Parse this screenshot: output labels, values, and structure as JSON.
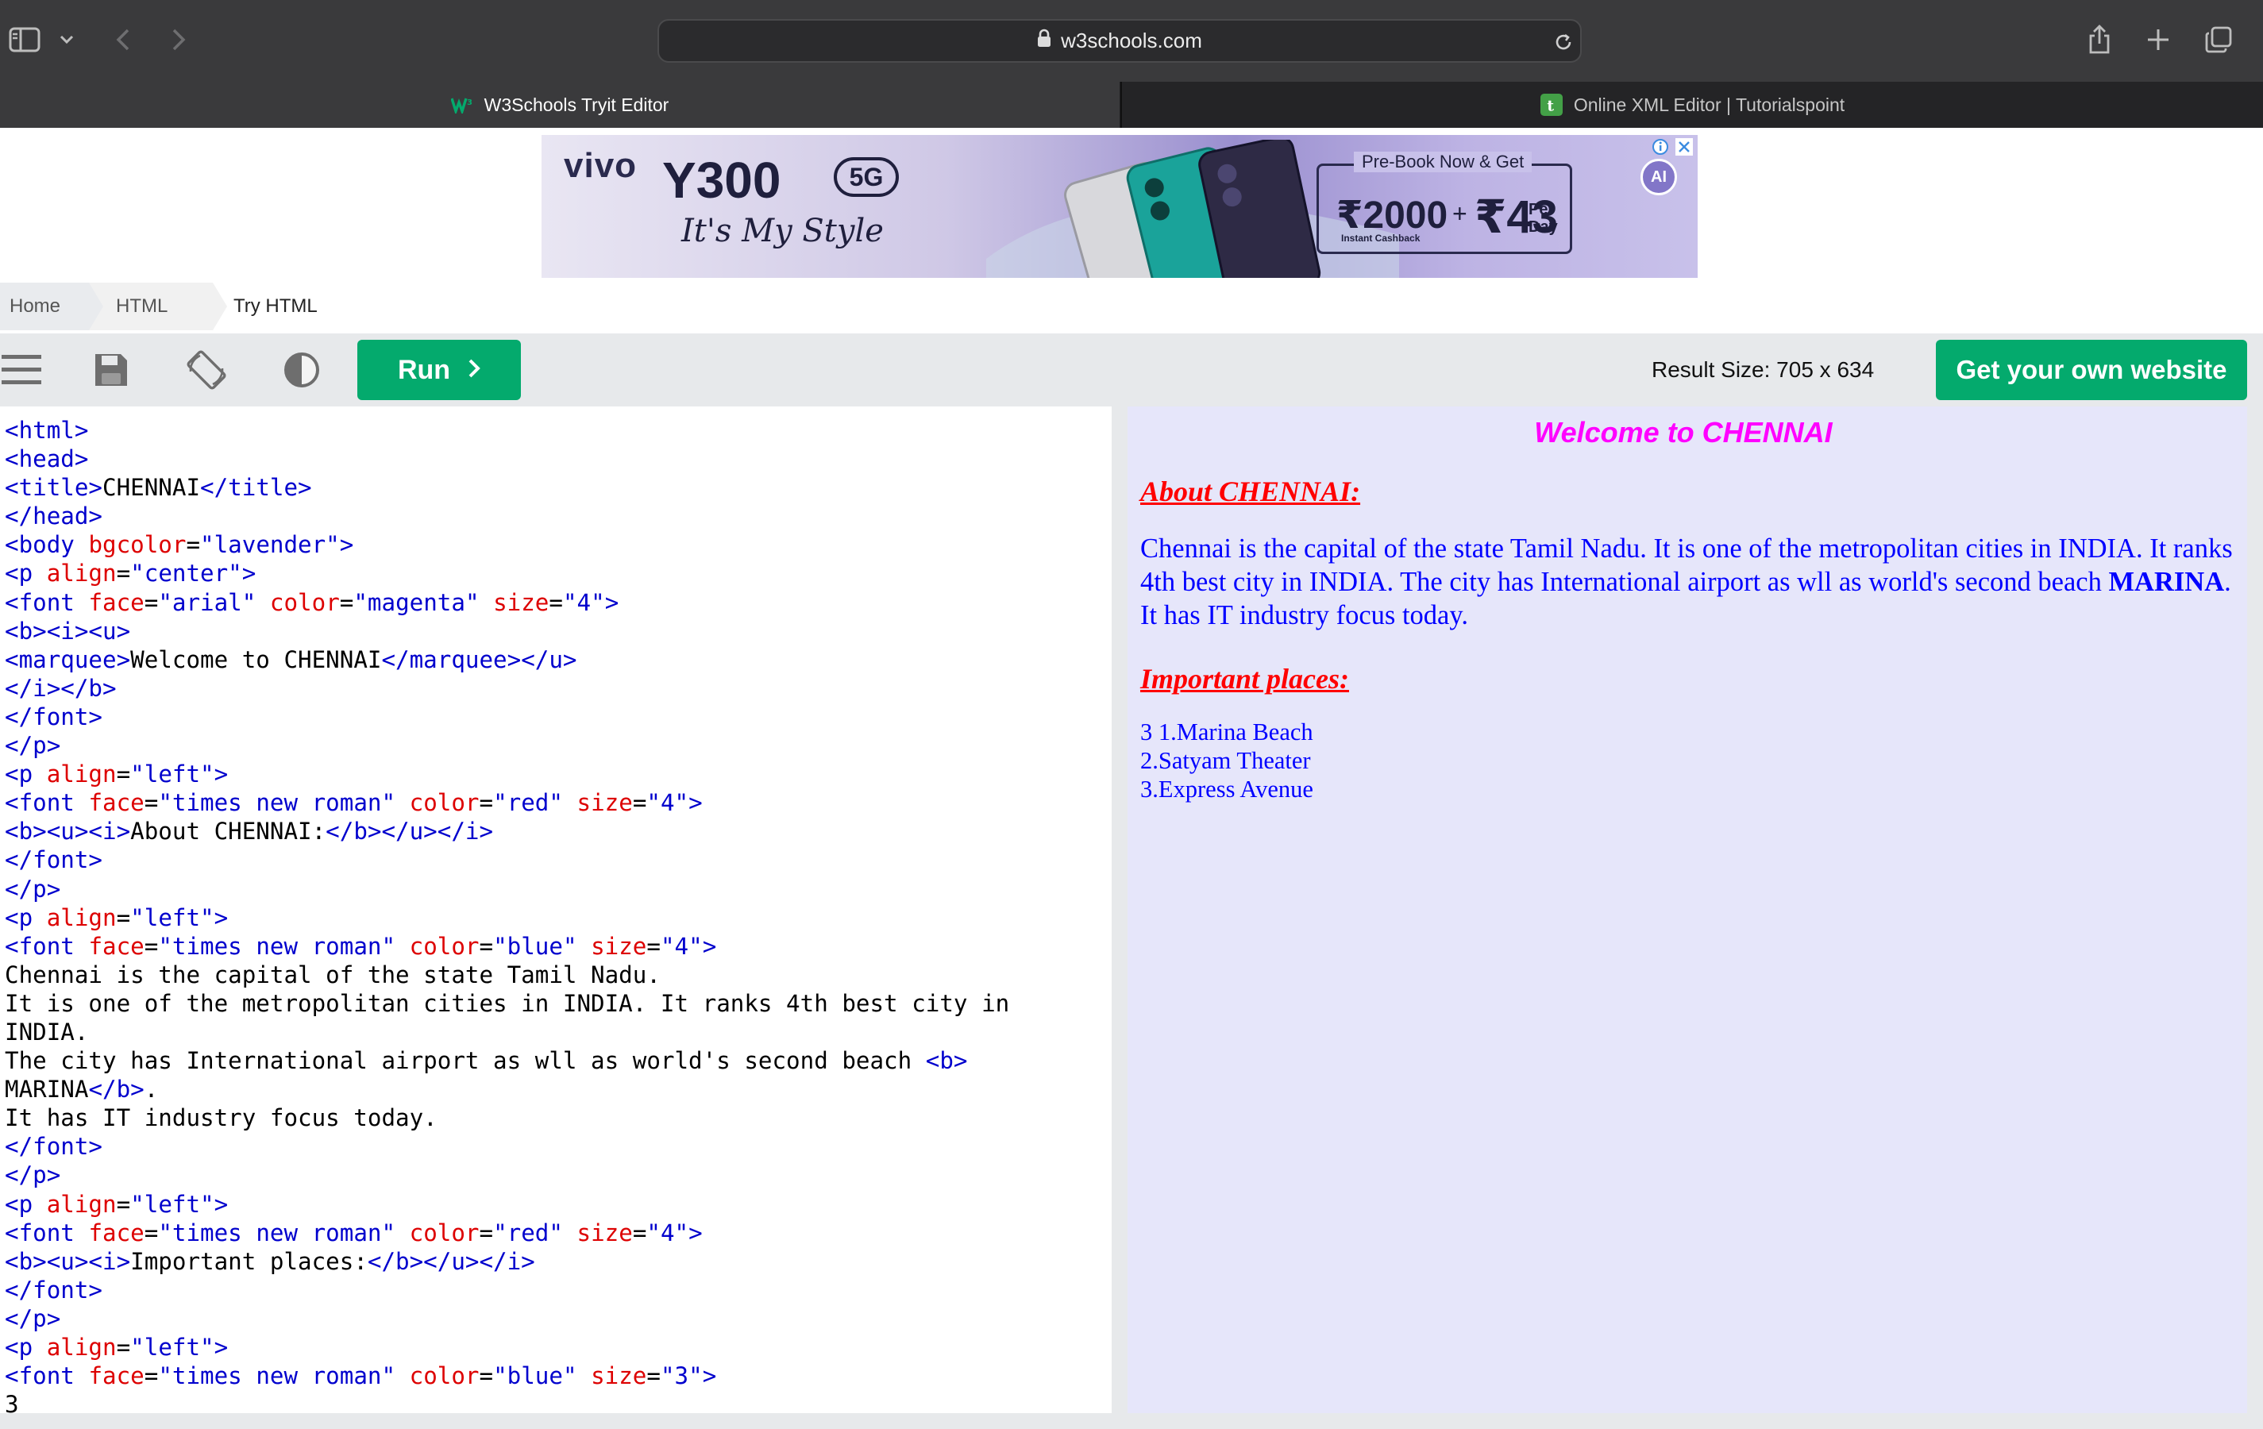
{
  "browser": {
    "url": "w3schools.com",
    "tabs": [
      {
        "label": "W3Schools Tryit Editor",
        "active": true,
        "icon": "w3schools-favicon"
      },
      {
        "label": "Online XML Editor | Tutorialspoint",
        "active": false,
        "icon": "tutorialspoint-favicon"
      }
    ]
  },
  "ad": {
    "brand": "vivo",
    "model": "Y300",
    "badge": "5G",
    "tagline": "It's My Style",
    "offer_title": "Pre-Book Now & Get",
    "amount1": "₹2000",
    "amount_sep": "+",
    "amount2": "₹43",
    "per": "Per",
    "day": "Day",
    "cashback": "Instant Cashback",
    "ai_label": "AI"
  },
  "breadcrumb": [
    "Home",
    "HTML",
    "Try HTML"
  ],
  "toolbar": {
    "run_label": "Run",
    "result_size": "Result Size: 705 x 634",
    "own_website": "Get your own website"
  },
  "editor": {
    "lines": [
      [
        [
          "tg",
          "<html>"
        ]
      ],
      [
        [
          "tg",
          "<head>"
        ]
      ],
      [
        [
          "tg",
          "<title>"
        ],
        [
          "tx",
          "CHENNAI"
        ],
        [
          "tg",
          "</title>"
        ]
      ],
      [
        [
          "tg",
          "</head>"
        ]
      ],
      [
        [
          "tg",
          "<body "
        ],
        [
          "at",
          "bgcolor"
        ],
        [
          "tx",
          "="
        ],
        [
          "vl",
          "\"lavender\""
        ],
        [
          "tg",
          ">"
        ]
      ],
      [
        [
          "tg",
          "<p "
        ],
        [
          "at",
          "align"
        ],
        [
          "tx",
          "="
        ],
        [
          "vl",
          "\"center\""
        ],
        [
          "tg",
          ">"
        ]
      ],
      [
        [
          "tg",
          "<font "
        ],
        [
          "at",
          "face"
        ],
        [
          "tx",
          "="
        ],
        [
          "vl",
          "\"arial\""
        ],
        [
          "tx",
          " "
        ],
        [
          "at",
          "color"
        ],
        [
          "tx",
          "="
        ],
        [
          "vl",
          "\"magenta\""
        ],
        [
          "tx",
          " "
        ],
        [
          "at",
          "size"
        ],
        [
          "tx",
          "="
        ],
        [
          "vl",
          "\"4\""
        ],
        [
          "tg",
          ">"
        ]
      ],
      [
        [
          "tg",
          "<b><i><u>"
        ]
      ],
      [
        [
          "tg",
          "<marquee>"
        ],
        [
          "tx",
          "Welcome to CHENNAI"
        ],
        [
          "tg",
          "</marquee></u>"
        ]
      ],
      [
        [
          "tg",
          "</i></b>"
        ]
      ],
      [
        [
          "tg",
          "</font>"
        ]
      ],
      [
        [
          "tg",
          "</p>"
        ]
      ],
      [
        [
          "tg",
          "<p "
        ],
        [
          "at",
          "align"
        ],
        [
          "tx",
          "="
        ],
        [
          "vl",
          "\"left\""
        ],
        [
          "tg",
          ">"
        ]
      ],
      [
        [
          "tg",
          "<font "
        ],
        [
          "at",
          "face"
        ],
        [
          "tx",
          "="
        ],
        [
          "vl",
          "\"times new roman\""
        ],
        [
          "tx",
          " "
        ],
        [
          "at",
          "color"
        ],
        [
          "tx",
          "="
        ],
        [
          "vl",
          "\"red\""
        ],
        [
          "tx",
          " "
        ],
        [
          "at",
          "size"
        ],
        [
          "tx",
          "="
        ],
        [
          "vl",
          "\"4\""
        ],
        [
          "tg",
          ">"
        ]
      ],
      [
        [
          "tg",
          "<b><u><i>"
        ],
        [
          "tx",
          "About CHENNAI:"
        ],
        [
          "tg",
          "</b></u></i>"
        ]
      ],
      [
        [
          "tg",
          "</font>"
        ]
      ],
      [
        [
          "tg",
          "</p>"
        ]
      ],
      [
        [
          "tg",
          "<p "
        ],
        [
          "at",
          "align"
        ],
        [
          "tx",
          "="
        ],
        [
          "vl",
          "\"left\""
        ],
        [
          "tg",
          ">"
        ]
      ],
      [
        [
          "tg",
          "<font "
        ],
        [
          "at",
          "face"
        ],
        [
          "tx",
          "="
        ],
        [
          "vl",
          "\"times new roman\""
        ],
        [
          "tx",
          " "
        ],
        [
          "at",
          "color"
        ],
        [
          "tx",
          "="
        ],
        [
          "vl",
          "\"blue\""
        ],
        [
          "tx",
          " "
        ],
        [
          "at",
          "size"
        ],
        [
          "tx",
          "="
        ],
        [
          "vl",
          "\"4\""
        ],
        [
          "tg",
          ">"
        ]
      ],
      [
        [
          "tx",
          "Chennai is the capital of the state Tamil Nadu."
        ]
      ],
      [
        [
          "tx",
          "It is one of the metropolitan cities in INDIA. It ranks 4th best city in"
        ]
      ],
      [
        [
          "tx",
          "INDIA."
        ]
      ],
      [
        [
          "tx",
          "The city has International airport as wll as world's second beach "
        ],
        [
          "tg",
          "<b>"
        ]
      ],
      [
        [
          "tx",
          "MARINA"
        ],
        [
          "tg",
          "</b>"
        ],
        [
          "tx",
          "."
        ]
      ],
      [
        [
          "tx",
          "It has IT industry focus today."
        ]
      ],
      [
        [
          "tg",
          "</font>"
        ]
      ],
      [
        [
          "tg",
          "</p>"
        ]
      ],
      [
        [
          "tg",
          "<p "
        ],
        [
          "at",
          "align"
        ],
        [
          "tx",
          "="
        ],
        [
          "vl",
          "\"left\""
        ],
        [
          "tg",
          ">"
        ]
      ],
      [
        [
          "tg",
          "<font "
        ],
        [
          "at",
          "face"
        ],
        [
          "tx",
          "="
        ],
        [
          "vl",
          "\"times new roman\""
        ],
        [
          "tx",
          " "
        ],
        [
          "at",
          "color"
        ],
        [
          "tx",
          "="
        ],
        [
          "vl",
          "\"red\""
        ],
        [
          "tx",
          " "
        ],
        [
          "at",
          "size"
        ],
        [
          "tx",
          "="
        ],
        [
          "vl",
          "\"4\""
        ],
        [
          "tg",
          ">"
        ]
      ],
      [
        [
          "tg",
          "<b><u><i>"
        ],
        [
          "tx",
          "Important places:"
        ],
        [
          "tg",
          "</b></u></i>"
        ]
      ],
      [
        [
          "tg",
          "</font>"
        ]
      ],
      [
        [
          "tg",
          "</p>"
        ]
      ],
      [
        [
          "tg",
          "<p "
        ],
        [
          "at",
          "align"
        ],
        [
          "tx",
          "="
        ],
        [
          "vl",
          "\"left\""
        ],
        [
          "tg",
          ">"
        ]
      ],
      [
        [
          "tg",
          "<font "
        ],
        [
          "at",
          "face"
        ],
        [
          "tx",
          "="
        ],
        [
          "vl",
          "\"times new roman\""
        ],
        [
          "tx",
          " "
        ],
        [
          "at",
          "color"
        ],
        [
          "tx",
          "="
        ],
        [
          "vl",
          "\"blue\""
        ],
        [
          "tx",
          " "
        ],
        [
          "at",
          "size"
        ],
        [
          "tx",
          "="
        ],
        [
          "vl",
          "\"3\""
        ],
        [
          "tg",
          ">"
        ]
      ],
      [
        [
          "tx",
          "3"
        ]
      ]
    ]
  },
  "result": {
    "background": "#e6e6fa",
    "marquee": "Welcome to CHENNAI",
    "about_heading": "About CHENNAI:",
    "about_text_before": "Chennai is the capital of the state Tamil Nadu. It is one of the metropolitan cities in INDIA. It ranks 4th best city in INDIA. The city has International airport as wll as world's second beach ",
    "about_bold": "MARINA",
    "about_text_after": ". It has IT industry focus today.",
    "places_heading": "Important places:",
    "places": [
      "3 1.Marina Beach",
      "2.Satyam Theater",
      "3.Express Avenue"
    ]
  },
  "colors": {
    "accent_green": "#04aa6d",
    "tag": "#0000cd",
    "attribute": "#dd0000",
    "magenta": "#ff00ff",
    "red": "#ff0000",
    "blue": "#0000ff"
  }
}
